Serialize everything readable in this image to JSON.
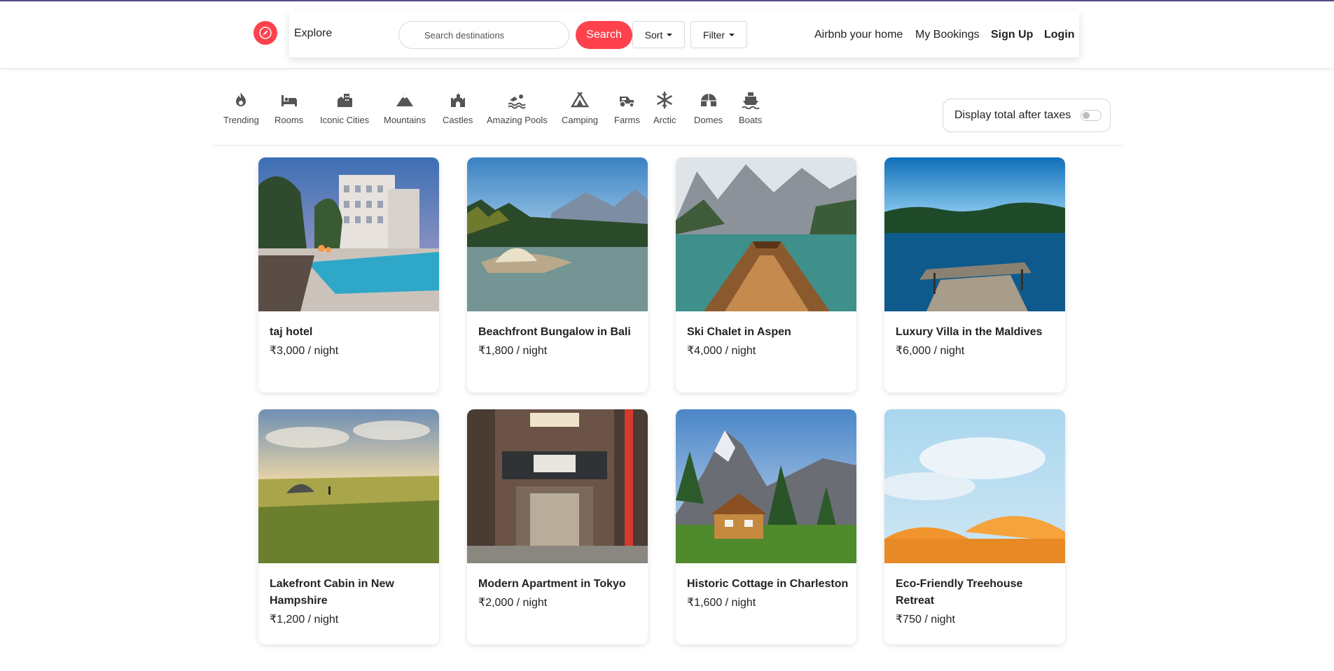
{
  "nav": {
    "explore": "Explore",
    "search_placeholder": "Search destinations",
    "search_button": "Search",
    "sort": "Sort",
    "filter": "Filter",
    "links": [
      "Airbnb your home",
      "My Bookings",
      "Sign Up",
      "Login"
    ],
    "brand_color": "#fe424d"
  },
  "filters": [
    {
      "label": "Trending",
      "icon": "fire-icon"
    },
    {
      "label": "Rooms",
      "icon": "bed-icon"
    },
    {
      "label": "Iconic Cities",
      "icon": "city-icon"
    },
    {
      "label": "Mountains",
      "icon": "mountain-icon"
    },
    {
      "label": "Castles",
      "icon": "castle-icon"
    },
    {
      "label": "Amazing Pools",
      "icon": "swimmer-icon"
    },
    {
      "label": "Camping",
      "icon": "tent-icon"
    },
    {
      "label": "Farms",
      "icon": "tractor-icon"
    },
    {
      "label": "Arctic",
      "icon": "snowflake-icon"
    },
    {
      "label": "Domes",
      "icon": "igloo-icon"
    },
    {
      "label": "Boats",
      "icon": "ship-icon"
    }
  ],
  "tax_toggle": {
    "label": "Display total after taxes",
    "enabled": false
  },
  "listings": [
    {
      "title": "taj hotel",
      "price": "₹3,000 / night",
      "image": "hotel-pool-photo"
    },
    {
      "title": "Beachfront Bungalow in Bali",
      "price": "₹1,800 / night",
      "image": "lake-tent-photo"
    },
    {
      "title": "Ski Chalet in Aspen",
      "price": "₹4,000 / night",
      "image": "mountain-lake-boat-photo"
    },
    {
      "title": "Luxury Villa in the Maldives",
      "price": "₹6,000 / night",
      "image": "lake-dock-photo"
    },
    {
      "title": "Lakefront Cabin in New Hampshire",
      "price": "₹1,200 / night",
      "image": "grassland-tent-photo"
    },
    {
      "title": "Modern Apartment in Tokyo",
      "price": "₹2,000 / night",
      "image": "tokyo-shopfront-photo"
    },
    {
      "title": "Historic Cottage in Charleston",
      "price": "₹1,600 / night",
      "image": "mountain-cabin-photo"
    },
    {
      "title": "Eco-Friendly Treehouse Retreat",
      "price": "₹750 / night",
      "image": "beach-umbrellas-photo"
    }
  ]
}
